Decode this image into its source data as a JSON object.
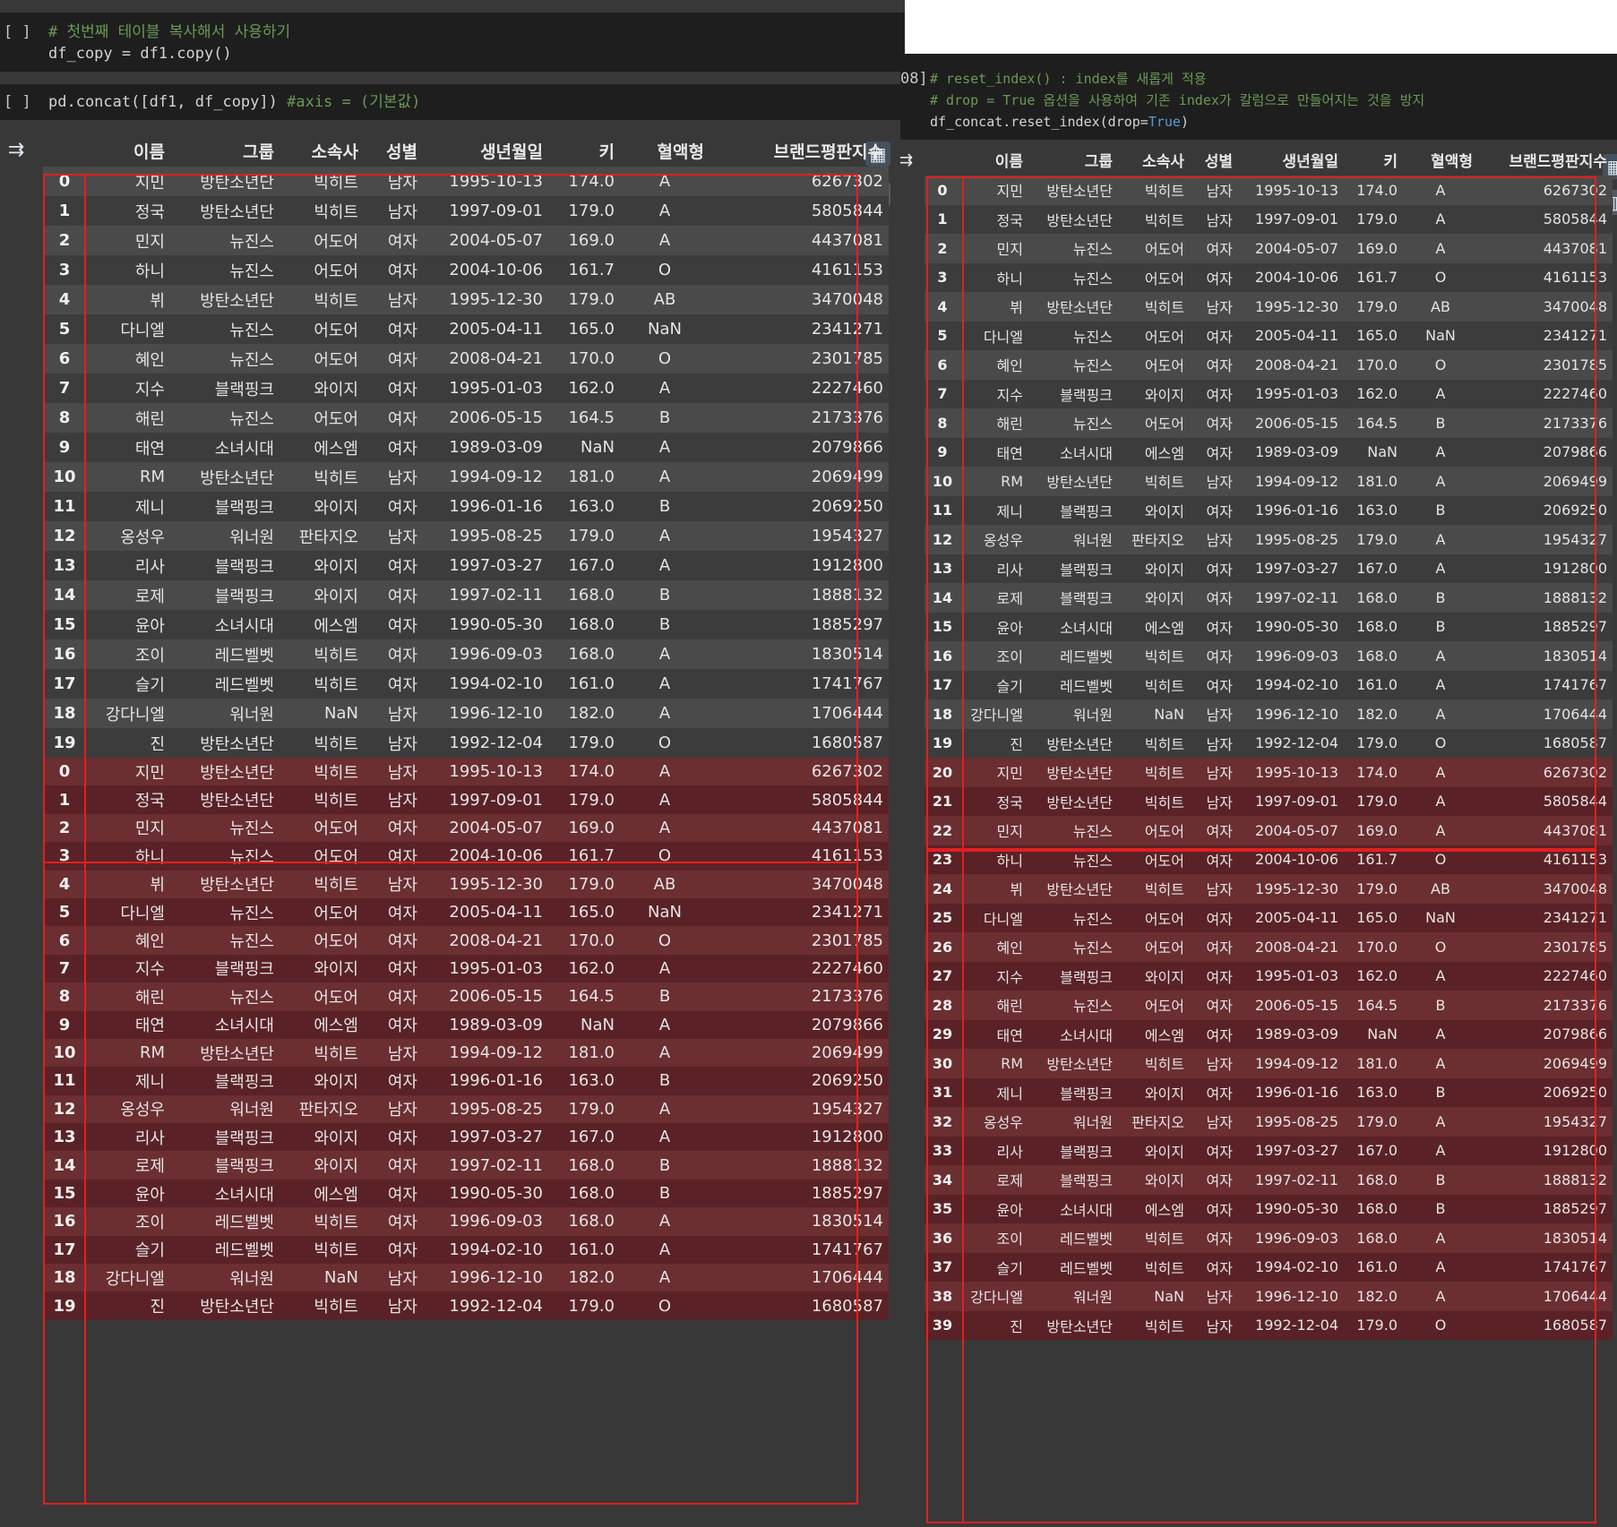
{
  "left": {
    "cell1": {
      "bracket": "[ ]",
      "comment": "# 첫번째 테이블 복사해서 사용하기",
      "code": "df_copy = df1.copy()"
    },
    "cell2": {
      "bracket": "[ ]",
      "code": "pd.concat([df1, df_copy]) ",
      "comment": "#axis = (기본값)"
    },
    "index_labels": [
      "0",
      "1",
      "2",
      "3",
      "4",
      "5",
      "6",
      "7",
      "8",
      "9",
      "10",
      "11",
      "12",
      "13",
      "14",
      "15",
      "16",
      "17",
      "18",
      "19",
      "0",
      "1",
      "2",
      "3",
      "4",
      "5",
      "6",
      "7",
      "8",
      "9",
      "10",
      "11",
      "12",
      "13",
      "14",
      "15",
      "16",
      "17",
      "18",
      "19"
    ]
  },
  "right": {
    "cell": {
      "bracket": "08]",
      "comment1": "# reset_index() : index를 새롭게 적용",
      "comment2": "# drop = True 옵션을 사용하여 기존 index가 칼럼으로 만들어지는 것을 방지",
      "code_pre": "df_concat.reset_index(drop=",
      "code_kw": "True",
      "code_post": ")"
    },
    "index_labels": [
      "0",
      "1",
      "2",
      "3",
      "4",
      "5",
      "6",
      "7",
      "8",
      "9",
      "10",
      "11",
      "12",
      "13",
      "14",
      "15",
      "16",
      "17",
      "18",
      "19",
      "20",
      "21",
      "22",
      "23",
      "24",
      "25",
      "26",
      "27",
      "28",
      "29",
      "30",
      "31",
      "32",
      "33",
      "34",
      "35",
      "36",
      "37",
      "38",
      "39"
    ]
  },
  "columns": [
    "이름",
    "그룹",
    "소속사",
    "성별",
    "생년월일",
    "키",
    "혈액형",
    "브랜드평판지수"
  ],
  "rows": [
    [
      "지민",
      "방탄소년단",
      "빅히트",
      "남자",
      "1995-10-13",
      "174.0",
      "A",
      "6267302"
    ],
    [
      "정국",
      "방탄소년단",
      "빅히트",
      "남자",
      "1997-09-01",
      "179.0",
      "A",
      "5805844"
    ],
    [
      "민지",
      "뉴진스",
      "어도어",
      "여자",
      "2004-05-07",
      "169.0",
      "A",
      "4437081"
    ],
    [
      "하니",
      "뉴진스",
      "어도어",
      "여자",
      "2004-10-06",
      "161.7",
      "O",
      "4161153"
    ],
    [
      "뷔",
      "방탄소년단",
      "빅히트",
      "남자",
      "1995-12-30",
      "179.0",
      "AB",
      "3470048"
    ],
    [
      "다니엘",
      "뉴진스",
      "어도어",
      "여자",
      "2005-04-11",
      "165.0",
      "NaN",
      "2341271"
    ],
    [
      "혜인",
      "뉴진스",
      "어도어",
      "여자",
      "2008-04-21",
      "170.0",
      "O",
      "2301785"
    ],
    [
      "지수",
      "블랙핑크",
      "와이지",
      "여자",
      "1995-01-03",
      "162.0",
      "A",
      "2227460"
    ],
    [
      "해린",
      "뉴진스",
      "어도어",
      "여자",
      "2006-05-15",
      "164.5",
      "B",
      "2173376"
    ],
    [
      "태연",
      "소녀시대",
      "에스엠",
      "여자",
      "1989-03-09",
      "NaN",
      "A",
      "2079866"
    ],
    [
      "RM",
      "방탄소년단",
      "빅히트",
      "남자",
      "1994-09-12",
      "181.0",
      "A",
      "2069499"
    ],
    [
      "제니",
      "블랙핑크",
      "와이지",
      "여자",
      "1996-01-16",
      "163.0",
      "B",
      "2069250"
    ],
    [
      "옹성우",
      "워너원",
      "판타지오",
      "남자",
      "1995-08-25",
      "179.0",
      "A",
      "1954327"
    ],
    [
      "리사",
      "블랙핑크",
      "와이지",
      "여자",
      "1997-03-27",
      "167.0",
      "A",
      "1912800"
    ],
    [
      "로제",
      "블랙핑크",
      "와이지",
      "여자",
      "1997-02-11",
      "168.0",
      "B",
      "1888132"
    ],
    [
      "윤아",
      "소녀시대",
      "에스엠",
      "여자",
      "1990-05-30",
      "168.0",
      "B",
      "1885297"
    ],
    [
      "조이",
      "레드벨벳",
      "빅히트",
      "여자",
      "1996-09-03",
      "168.0",
      "A",
      "1830514"
    ],
    [
      "슬기",
      "레드벨벳",
      "빅히트",
      "여자",
      "1994-02-10",
      "161.0",
      "A",
      "1741767"
    ],
    [
      "강다니엘",
      "워너원",
      "NaN",
      "남자",
      "1996-12-10",
      "182.0",
      "A",
      "1706444"
    ],
    [
      "진",
      "방탄소년단",
      "빅히트",
      "남자",
      "1992-12-04",
      "179.0",
      "O",
      "1680587"
    ]
  ],
  "icons": {
    "left_table_view": "table-grid-icon",
    "left_chart": "bar-chart-icon",
    "left_output": "output-menu-icon",
    "right_table_view": "table-grid-icon",
    "right_chart": "bar-chart-icon",
    "right_output": "output-menu-icon"
  },
  "colors": {
    "background": "#383838",
    "code_background": "#1e1e1e",
    "comment": "#6a9955",
    "highlight_box": "#e02020",
    "duplicated_rows": "#6b2e31"
  }
}
